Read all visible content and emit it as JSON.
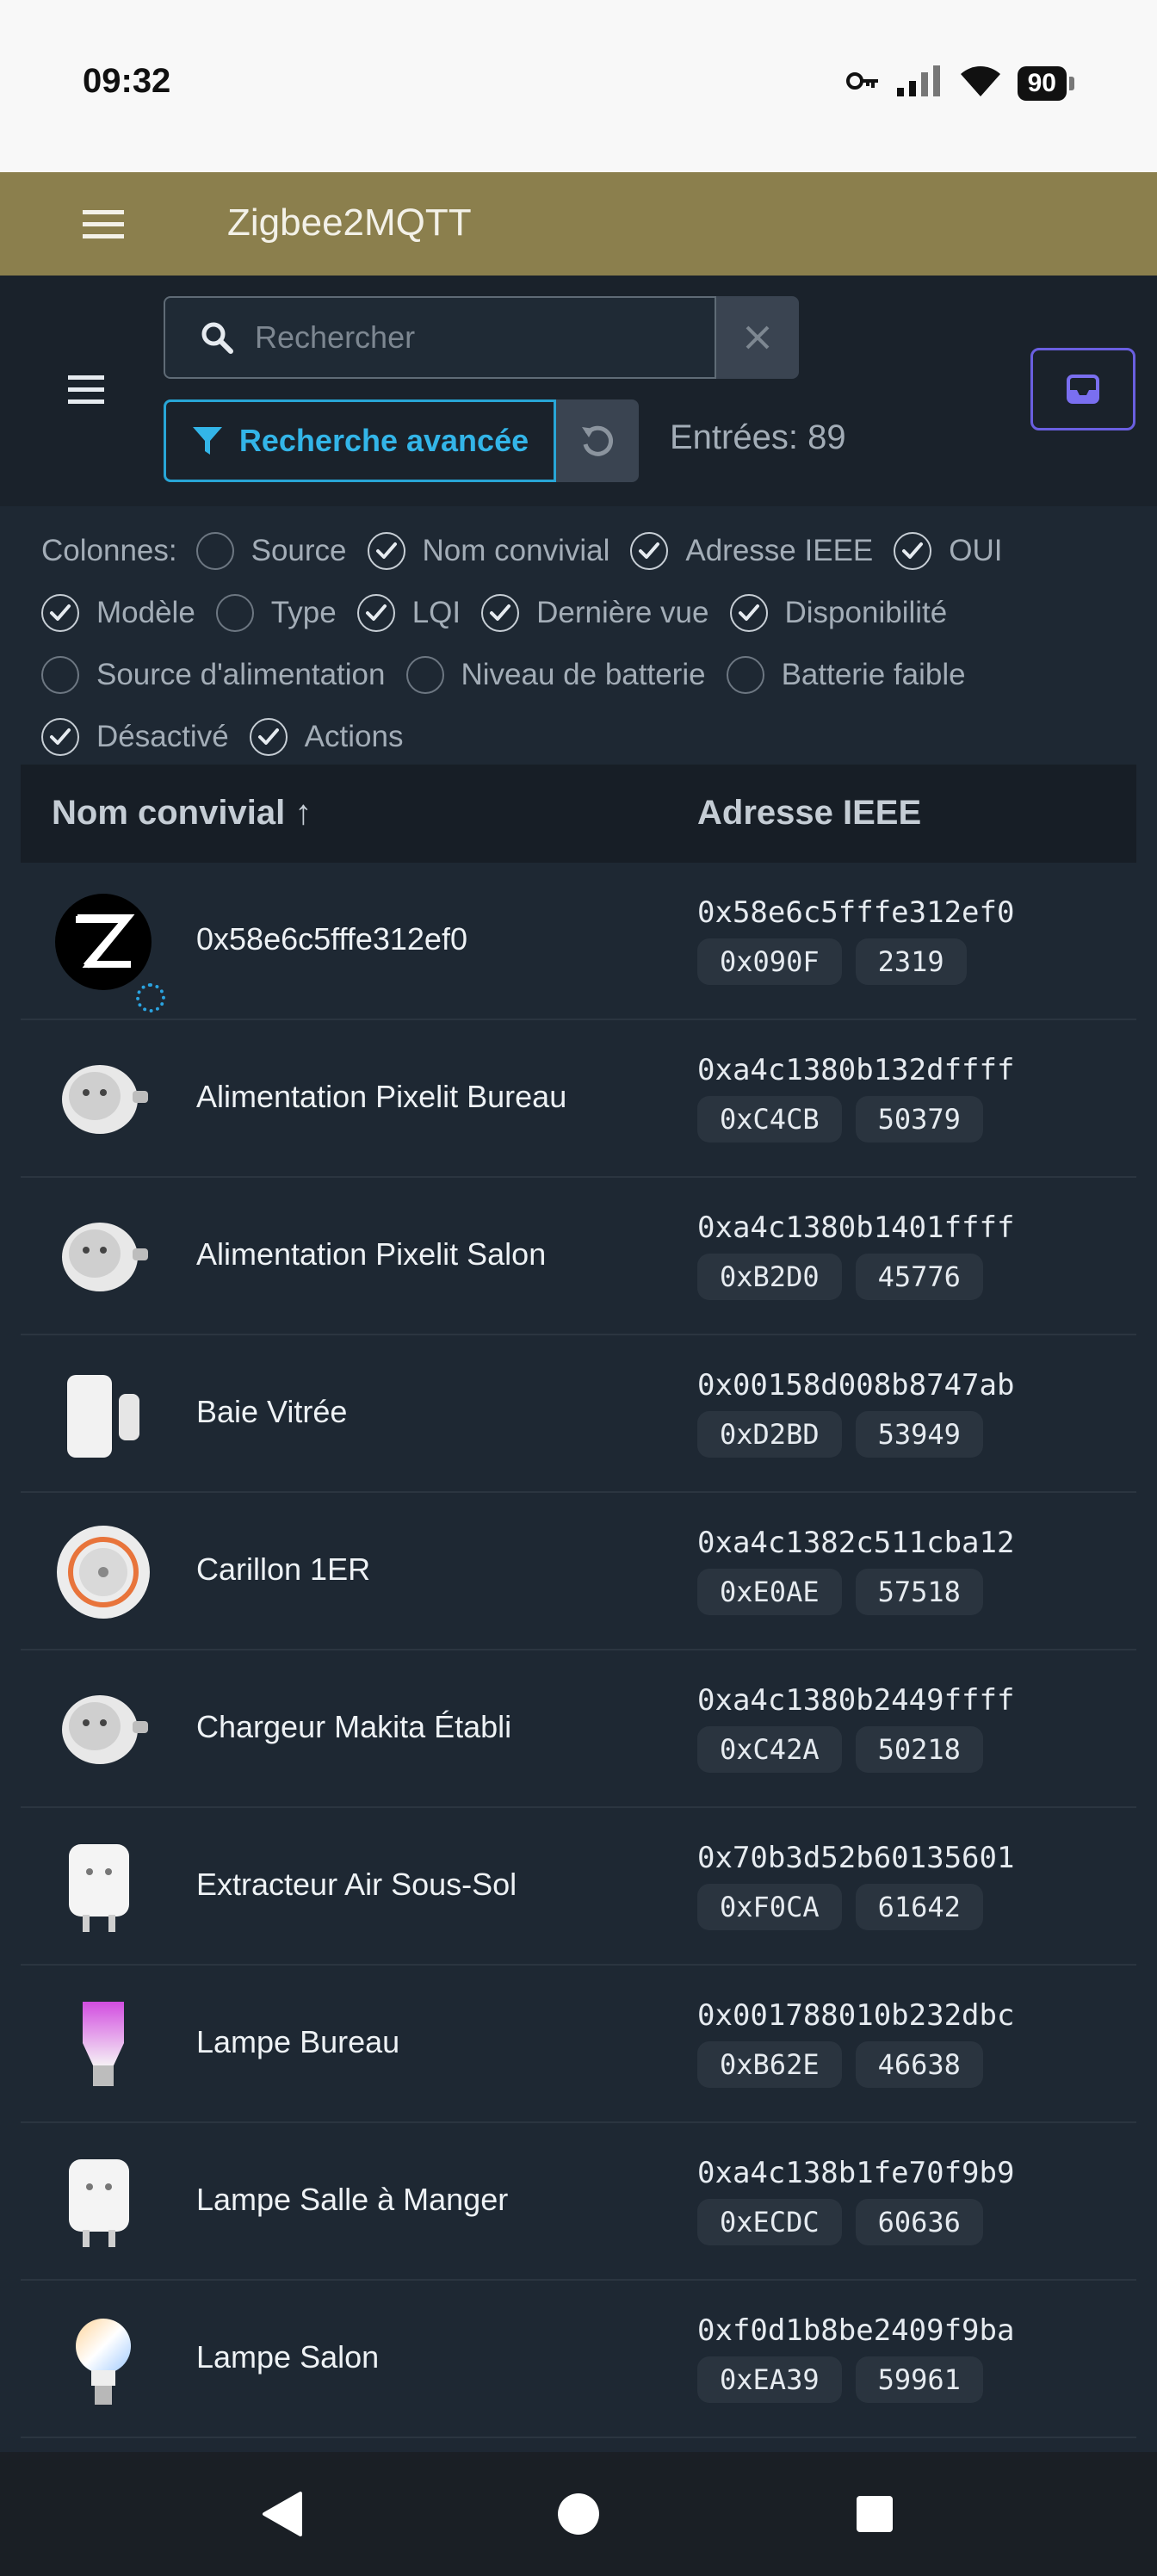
{
  "status_bar": {
    "time": "09:32",
    "battery": "90"
  },
  "app_bar": {
    "title": "Zigbee2MQTT"
  },
  "toolbar": {
    "search_placeholder": "Rechercher",
    "advanced_search_label": "Recherche avancée",
    "entries_text": "Entrées: 89"
  },
  "columns": {
    "label": "Colonnes:",
    "items": [
      {
        "label": "Source",
        "checked": false
      },
      {
        "label": "Nom convivial",
        "checked": true
      },
      {
        "label": "Adresse IEEE",
        "checked": true
      },
      {
        "label": "OUI",
        "checked": true
      },
      {
        "label": "Modèle",
        "checked": true
      },
      {
        "label": "Type",
        "checked": false
      },
      {
        "label": "LQI",
        "checked": true
      },
      {
        "label": "Dernière vue",
        "checked": true
      },
      {
        "label": "Disponibilité",
        "checked": true
      },
      {
        "label": "Source d'alimentation",
        "checked": false
      },
      {
        "label": "Niveau de batterie",
        "checked": false
      },
      {
        "label": "Batterie faible",
        "checked": false
      },
      {
        "label": "Désactivé",
        "checked": true
      },
      {
        "label": "Actions",
        "checked": true
      }
    ]
  },
  "table": {
    "header_name": "Nom convivial ↑",
    "header_ieee": "Adresse IEEE",
    "rows": [
      {
        "name": "0x58e6c5fffe312ef0",
        "ieee": "0x58e6c5fffe312ef0",
        "nwk": "0x090F",
        "nwk_dec": "2319",
        "icon": "zigbee-logo-icon"
      },
      {
        "name": "Alimentation Pixelit Bureau",
        "ieee": "0xa4c1380b132dffff",
        "nwk": "0xC4CB",
        "nwk_dec": "50379",
        "icon": "round-plug-icon"
      },
      {
        "name": "Alimentation Pixelit Salon",
        "ieee": "0xa4c1380b1401ffff",
        "nwk": "0xB2D0",
        "nwk_dec": "45776",
        "icon": "round-plug-icon"
      },
      {
        "name": "Baie Vitrée",
        "ieee": "0x00158d008b8747ab",
        "nwk": "0xD2BD",
        "nwk_dec": "53949",
        "icon": "door-sensor-icon"
      },
      {
        "name": "Carillon 1ER",
        "ieee": "0xa4c1382c511cba12",
        "nwk": "0xE0AE",
        "nwk_dec": "57518",
        "icon": "siren-icon"
      },
      {
        "name": "Chargeur Makita Établi",
        "ieee": "0xa4c1380b2449ffff",
        "nwk": "0xC42A",
        "nwk_dec": "50218",
        "icon": "round-plug-icon"
      },
      {
        "name": "Extracteur Air Sous-Sol",
        "ieee": "0x70b3d52b60135601",
        "nwk": "0xF0CA",
        "nwk_dec": "61642",
        "icon": "square-plug-icon"
      },
      {
        "name": "Lampe Bureau",
        "ieee": "0x001788010b232dbc",
        "nwk": "0xB62E",
        "nwk_dec": "46638",
        "icon": "color-bulb-icon"
      },
      {
        "name": "Lampe Salle à Manger",
        "ieee": "0xa4c138b1fe70f9b9",
        "nwk": "0xECDC",
        "nwk_dec": "60636",
        "icon": "square-plug-icon"
      },
      {
        "name": "Lampe Salon",
        "ieee": "0xf0d1b8be2409f9ba",
        "nwk": "0xEA39",
        "nwk_dec": "59961",
        "icon": "small-bulb-icon"
      }
    ]
  },
  "colors": {
    "app_bar": "#8b7f4d",
    "background": "#1e2833",
    "accent_blue": "#28a6d6",
    "inbox_purple": "#6a5fe0"
  }
}
